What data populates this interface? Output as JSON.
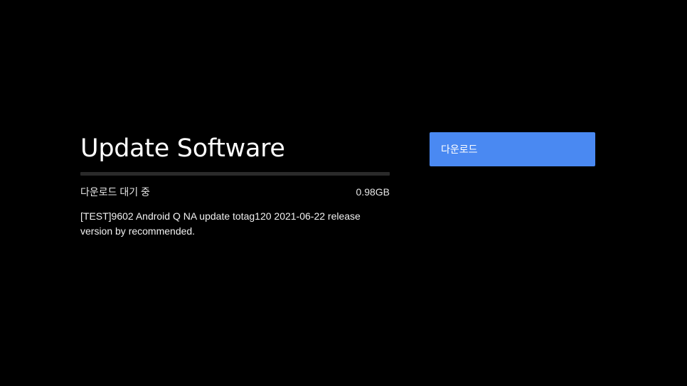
{
  "title": "Update Software",
  "download": {
    "status_text": "다운로드 대기 중",
    "size_text": "0.98GB",
    "progress_fraction": 0
  },
  "description": "[TEST]9602 Android Q NA update totag120 2021-06-22 release version by recommended.",
  "actions": {
    "download_label": "다운로드"
  },
  "colors": {
    "background": "#000000",
    "accent": "#4a89f2",
    "progress_track": "#2a2a2a",
    "text": "#ffffff"
  }
}
